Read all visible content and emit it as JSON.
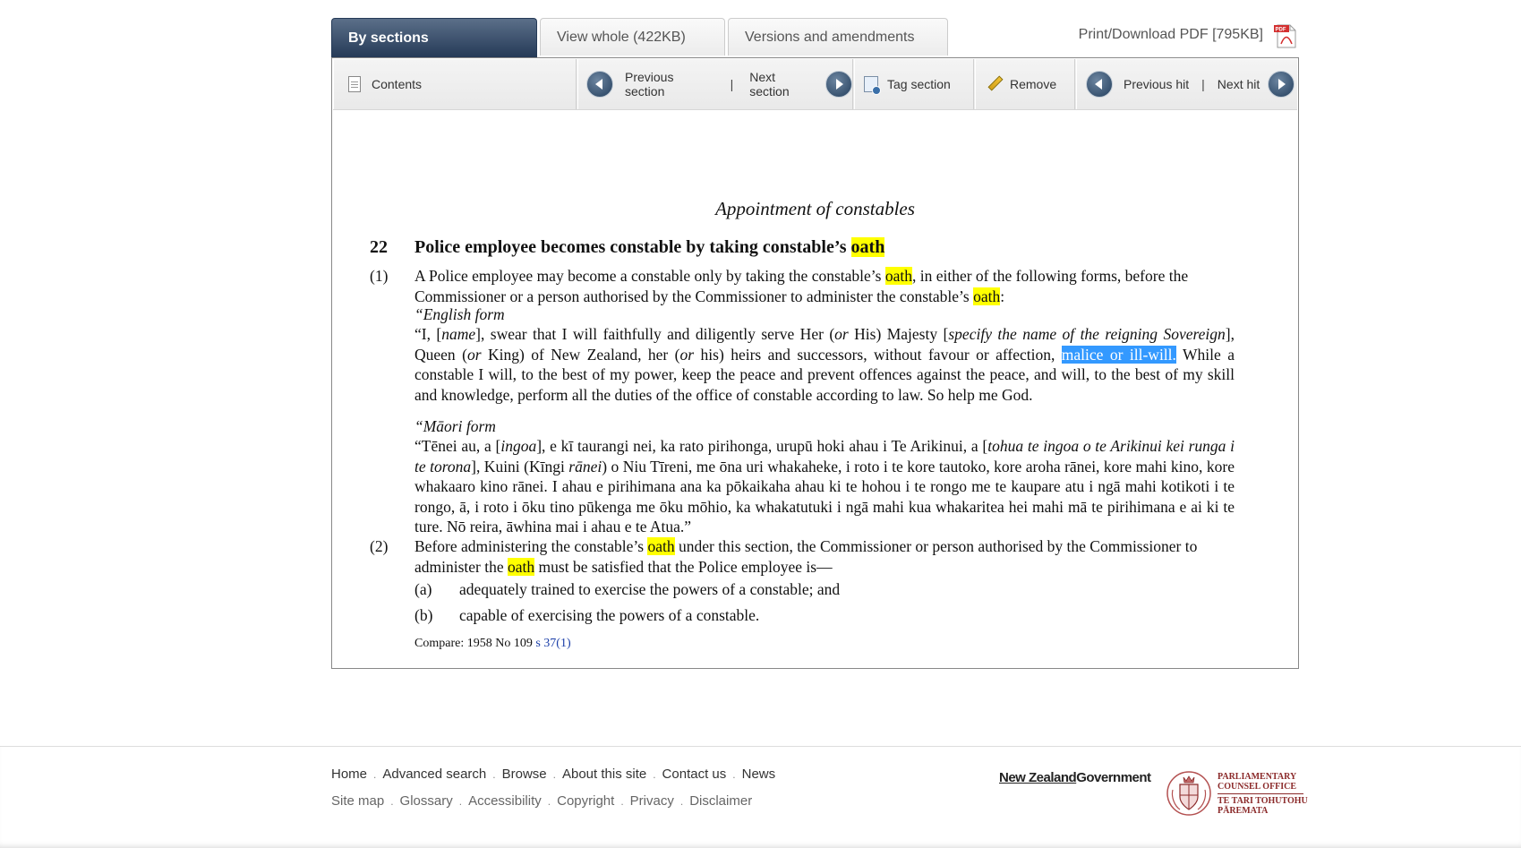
{
  "tabs": {
    "by_sections": "By sections",
    "view_whole": "View whole (422KB)",
    "versions": "Versions and amendments",
    "print_pdf": "Print/Download PDF [795KB]"
  },
  "toolbar": {
    "contents": "Contents",
    "previous_section": "Previous section",
    "separator": "|",
    "next_section": "Next section",
    "tag_section": "Tag section",
    "remove": "Remove",
    "previous_hit": "Previous hit",
    "next_hit": "Next hit"
  },
  "document": {
    "heading": "Appointment of constables",
    "section_number": "22",
    "section_title_pre": "Police employee becomes constable by taking constable’s ",
    "hit": "oath",
    "sub1_num": "(1)",
    "sub1_a": "A Police employee may become a constable only by taking the constable’s ",
    "sub1_b": ", in either of the following forms, before the Commissioner or a person authorised by the Commissioner to administer the constable’s ",
    "sub1_c": ":",
    "english_form_label": "“English form",
    "en_1": "“I, [",
    "en_name": "name",
    "en_2": "], swear that I will faithfully and diligently serve Her (",
    "en_or1": "or",
    "en_3": " His) Majesty [",
    "en_specify": "specify the name of the reigning Sovereign",
    "en_4": "], Queen (",
    "en_or2": "or",
    "en_5": " King) of New Zealand, her (",
    "en_or3": "or",
    "en_6": " his) heirs and successors, without favour or affection, ",
    "en_selected": "malice or ill-will.",
    "en_7": " While a constable I will, to the best of my power, keep the peace and prevent offences against the peace, and will, to the best of my skill and knowledge, perform all the duties of the office of constable according to law. So help me God.",
    "maori_form_label": "“Māori form",
    "mi_1": "“Tēnei au, a [",
    "mi_ingoa": "ingoa",
    "mi_2": "], e kī taurangi nei, ka rato pirihonga, urupū hoki ahau i Te Arikinui, a [",
    "mi_tohua": "tohua te ingoa o te Arikinui kei runga i te torona",
    "mi_3": "], Kuini (Kīngi ",
    "mi_ranei": "rānei",
    "mi_4": ") o Niu Tīreni, me ōna uri whakaheke, i roto i te kore tautoko, kore aroha rānei, kore mahi kino, kore whakaaro kino rānei. I ahau e pirihimana ana ka pōkaikaha ahau ki te hohou i te rongo me te kaupare atu i ngā mahi kotikoti i te rongo, ā, i roto i ōku tino pūkenga me ōku mōhio, ka whakatutuki i ngā mahi kua whakaritea hei mahi mā te pirihimana e ai ki te ture. Nō reira, āwhina mai i ahau e te Atua.”",
    "sub2_num": "(2)",
    "sub2_a": "Before administering the constable’s ",
    "sub2_b": " under this section, the Commissioner or person authorised by the Commissioner to administer the ",
    "sub2_c": " must be satisfied that the Police employee is—",
    "a_num": "(a)",
    "a_text": "adequately trained to exercise the powers of a constable; and",
    "b_num": "(b)",
    "b_text": "capable of exercising the powers of a constable.",
    "compare_text": "Compare: 1958 No 109 ",
    "compare_link": "s 37(1)"
  },
  "footer": {
    "links_row1": [
      "Home",
      "Advanced search",
      "Browse",
      "About this site",
      "Contact us",
      "News"
    ],
    "links_row2": [
      "Site map",
      "Glossary",
      "Accessibility",
      "Copyright",
      "Privacy",
      "Disclaimer"
    ],
    "dot": ".",
    "nzgov_a": "New Zealand",
    "nzgov_b": "Government",
    "pco_line1": "PARLIAMENTARY",
    "pco_line2": "COUNSEL OFFICE",
    "pco_line3": "TE TARI TOHUTOHU",
    "pco_line4": "PĀREMATA"
  },
  "colors": {
    "active_tab": "#253a57",
    "search_highlight": "#ffff00",
    "selection": "#3399ff",
    "link": "#1a3ea8"
  },
  "icons": [
    "document-icon",
    "arrow-left-icon",
    "arrow-right-icon",
    "tag-icon",
    "pencil-icon",
    "pdf-icon",
    "crest-icon"
  ]
}
